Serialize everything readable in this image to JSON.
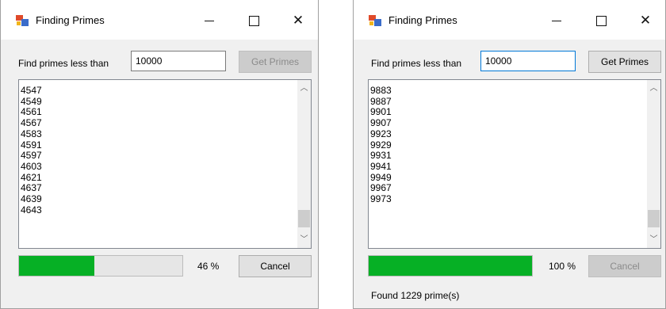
{
  "windows": [
    {
      "title": "Finding Primes",
      "find_label": "Find primes less than",
      "input_value": "10000",
      "get_primes_label": "Get Primes",
      "get_primes_enabled": false,
      "primes_list": [
        "4547",
        "4549",
        "4561",
        "4567",
        "4583",
        "4591",
        "4597",
        "4603",
        "4621",
        "4637",
        "4639",
        "4643"
      ],
      "progress": 0.46,
      "progress_text": "46 %",
      "cancel_label": "Cancel",
      "cancel_enabled": true,
      "status_text": ""
    },
    {
      "title": "Finding Primes",
      "find_label": "Find primes less than",
      "input_value": "10000",
      "get_primes_label": "Get Primes",
      "get_primes_enabled": true,
      "primes_list": [
        "9883",
        "9887",
        "9901",
        "9907",
        "9923",
        "9929",
        "9931",
        "9941",
        "9949",
        "9967",
        "9973"
      ],
      "progress": 1.0,
      "progress_text": "100 %",
      "cancel_label": "Cancel",
      "cancel_enabled": false,
      "status_text": "Found 1229 prime(s)"
    }
  ],
  "icons": {
    "minimize": "minimize-icon",
    "maximize": "maximize-icon",
    "close": "close-icon",
    "app": "app-icon",
    "scroll_up": "chevron-up-icon",
    "scroll_down": "chevron-down-icon"
  },
  "colors": {
    "progress_fill": "#06b025",
    "focus_border": "#0078d7",
    "window_bg": "#f0f0f0"
  }
}
